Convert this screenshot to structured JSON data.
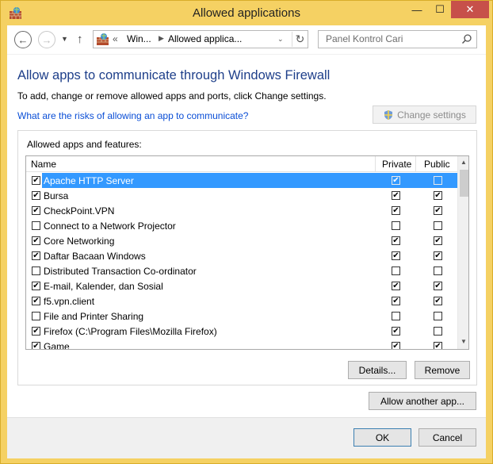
{
  "window": {
    "title": "Allowed applications",
    "minimize_glyph": "—",
    "maximize_glyph": "☐",
    "close_glyph": "✕"
  },
  "navbar": {
    "back_glyph": "←",
    "forward_glyph": "→",
    "dropdown_glyph": "▼",
    "up_glyph": "↑",
    "address": {
      "chevron": "«",
      "crumb1": "Win...",
      "separator": "▶",
      "crumb2": "Allowed applica...",
      "dropdown_glyph": "⌄",
      "refresh_glyph": "↻"
    },
    "search": {
      "placeholder": "Panel Kontrol Cari"
    }
  },
  "main": {
    "heading": "Allow apps to communicate through Windows Firewall",
    "description": "To add, change or remove allowed apps and ports, click Change settings.",
    "risk_link": "What are the risks of allowing an app to communicate?",
    "change_settings_label": "Change settings"
  },
  "apps_group": {
    "label": "Allowed apps and features:",
    "columns": {
      "name": "Name",
      "private": "Private",
      "public": "Public"
    },
    "rows": [
      {
        "name": "Apache HTTP Server",
        "enabled": true,
        "private": true,
        "public": false,
        "selected": true
      },
      {
        "name": "Bursa",
        "enabled": true,
        "private": true,
        "public": true,
        "selected": false
      },
      {
        "name": "CheckPoint.VPN",
        "enabled": true,
        "private": true,
        "public": true,
        "selected": false
      },
      {
        "name": "Connect to a Network Projector",
        "enabled": false,
        "private": false,
        "public": false,
        "selected": false
      },
      {
        "name": "Core Networking",
        "enabled": true,
        "private": true,
        "public": true,
        "selected": false
      },
      {
        "name": "Daftar Bacaan Windows",
        "enabled": true,
        "private": true,
        "public": true,
        "selected": false
      },
      {
        "name": "Distributed Transaction Co-ordinator",
        "enabled": false,
        "private": false,
        "public": false,
        "selected": false
      },
      {
        "name": "E-mail, Kalender, dan Sosial",
        "enabled": true,
        "private": true,
        "public": true,
        "selected": false
      },
      {
        "name": "f5.vpn.client",
        "enabled": true,
        "private": true,
        "public": true,
        "selected": false
      },
      {
        "name": "File and Printer Sharing",
        "enabled": false,
        "private": false,
        "public": false,
        "selected": false
      },
      {
        "name": "Firefox (C:\\Program Files\\Mozilla Firefox)",
        "enabled": true,
        "private": true,
        "public": false,
        "selected": false
      },
      {
        "name": "Game",
        "enabled": true,
        "private": true,
        "public": true,
        "selected": false
      }
    ],
    "details_label": "Details...",
    "remove_label": "Remove"
  },
  "allow_another_label": "Allow another app...",
  "footer": {
    "ok_label": "OK",
    "cancel_label": "Cancel"
  },
  "colors": {
    "accent": "#3399ff",
    "heading": "#1e3f8a",
    "link": "#0a4ed6",
    "frame": "#f5d163",
    "close": "#c7504a"
  }
}
